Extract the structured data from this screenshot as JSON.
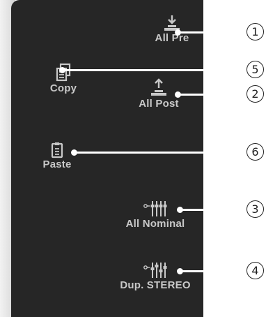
{
  "buttons": {
    "all_pre": "All Pre",
    "copy": "Copy",
    "all_post": "All Post",
    "paste": "Paste",
    "all_nominal": "All Nominal",
    "dup_stereo": "Dup. STEREO"
  },
  "callouts": [
    "1",
    "2",
    "3",
    "4",
    "5",
    "6"
  ],
  "colors": {
    "panel": "#262626",
    "button_text": "#c8c8c8",
    "callout_line": "#ffffff"
  },
  "icons": {
    "all_pre": "arrow-down-to-bar-icon",
    "copy": "copy-documents-icon",
    "all_post": "arrow-up-from-bar-icon",
    "paste": "clipboard-icon",
    "all_nominal": "fader-sliders-icon",
    "dup_stereo": "fader-sliders-offset-icon"
  }
}
